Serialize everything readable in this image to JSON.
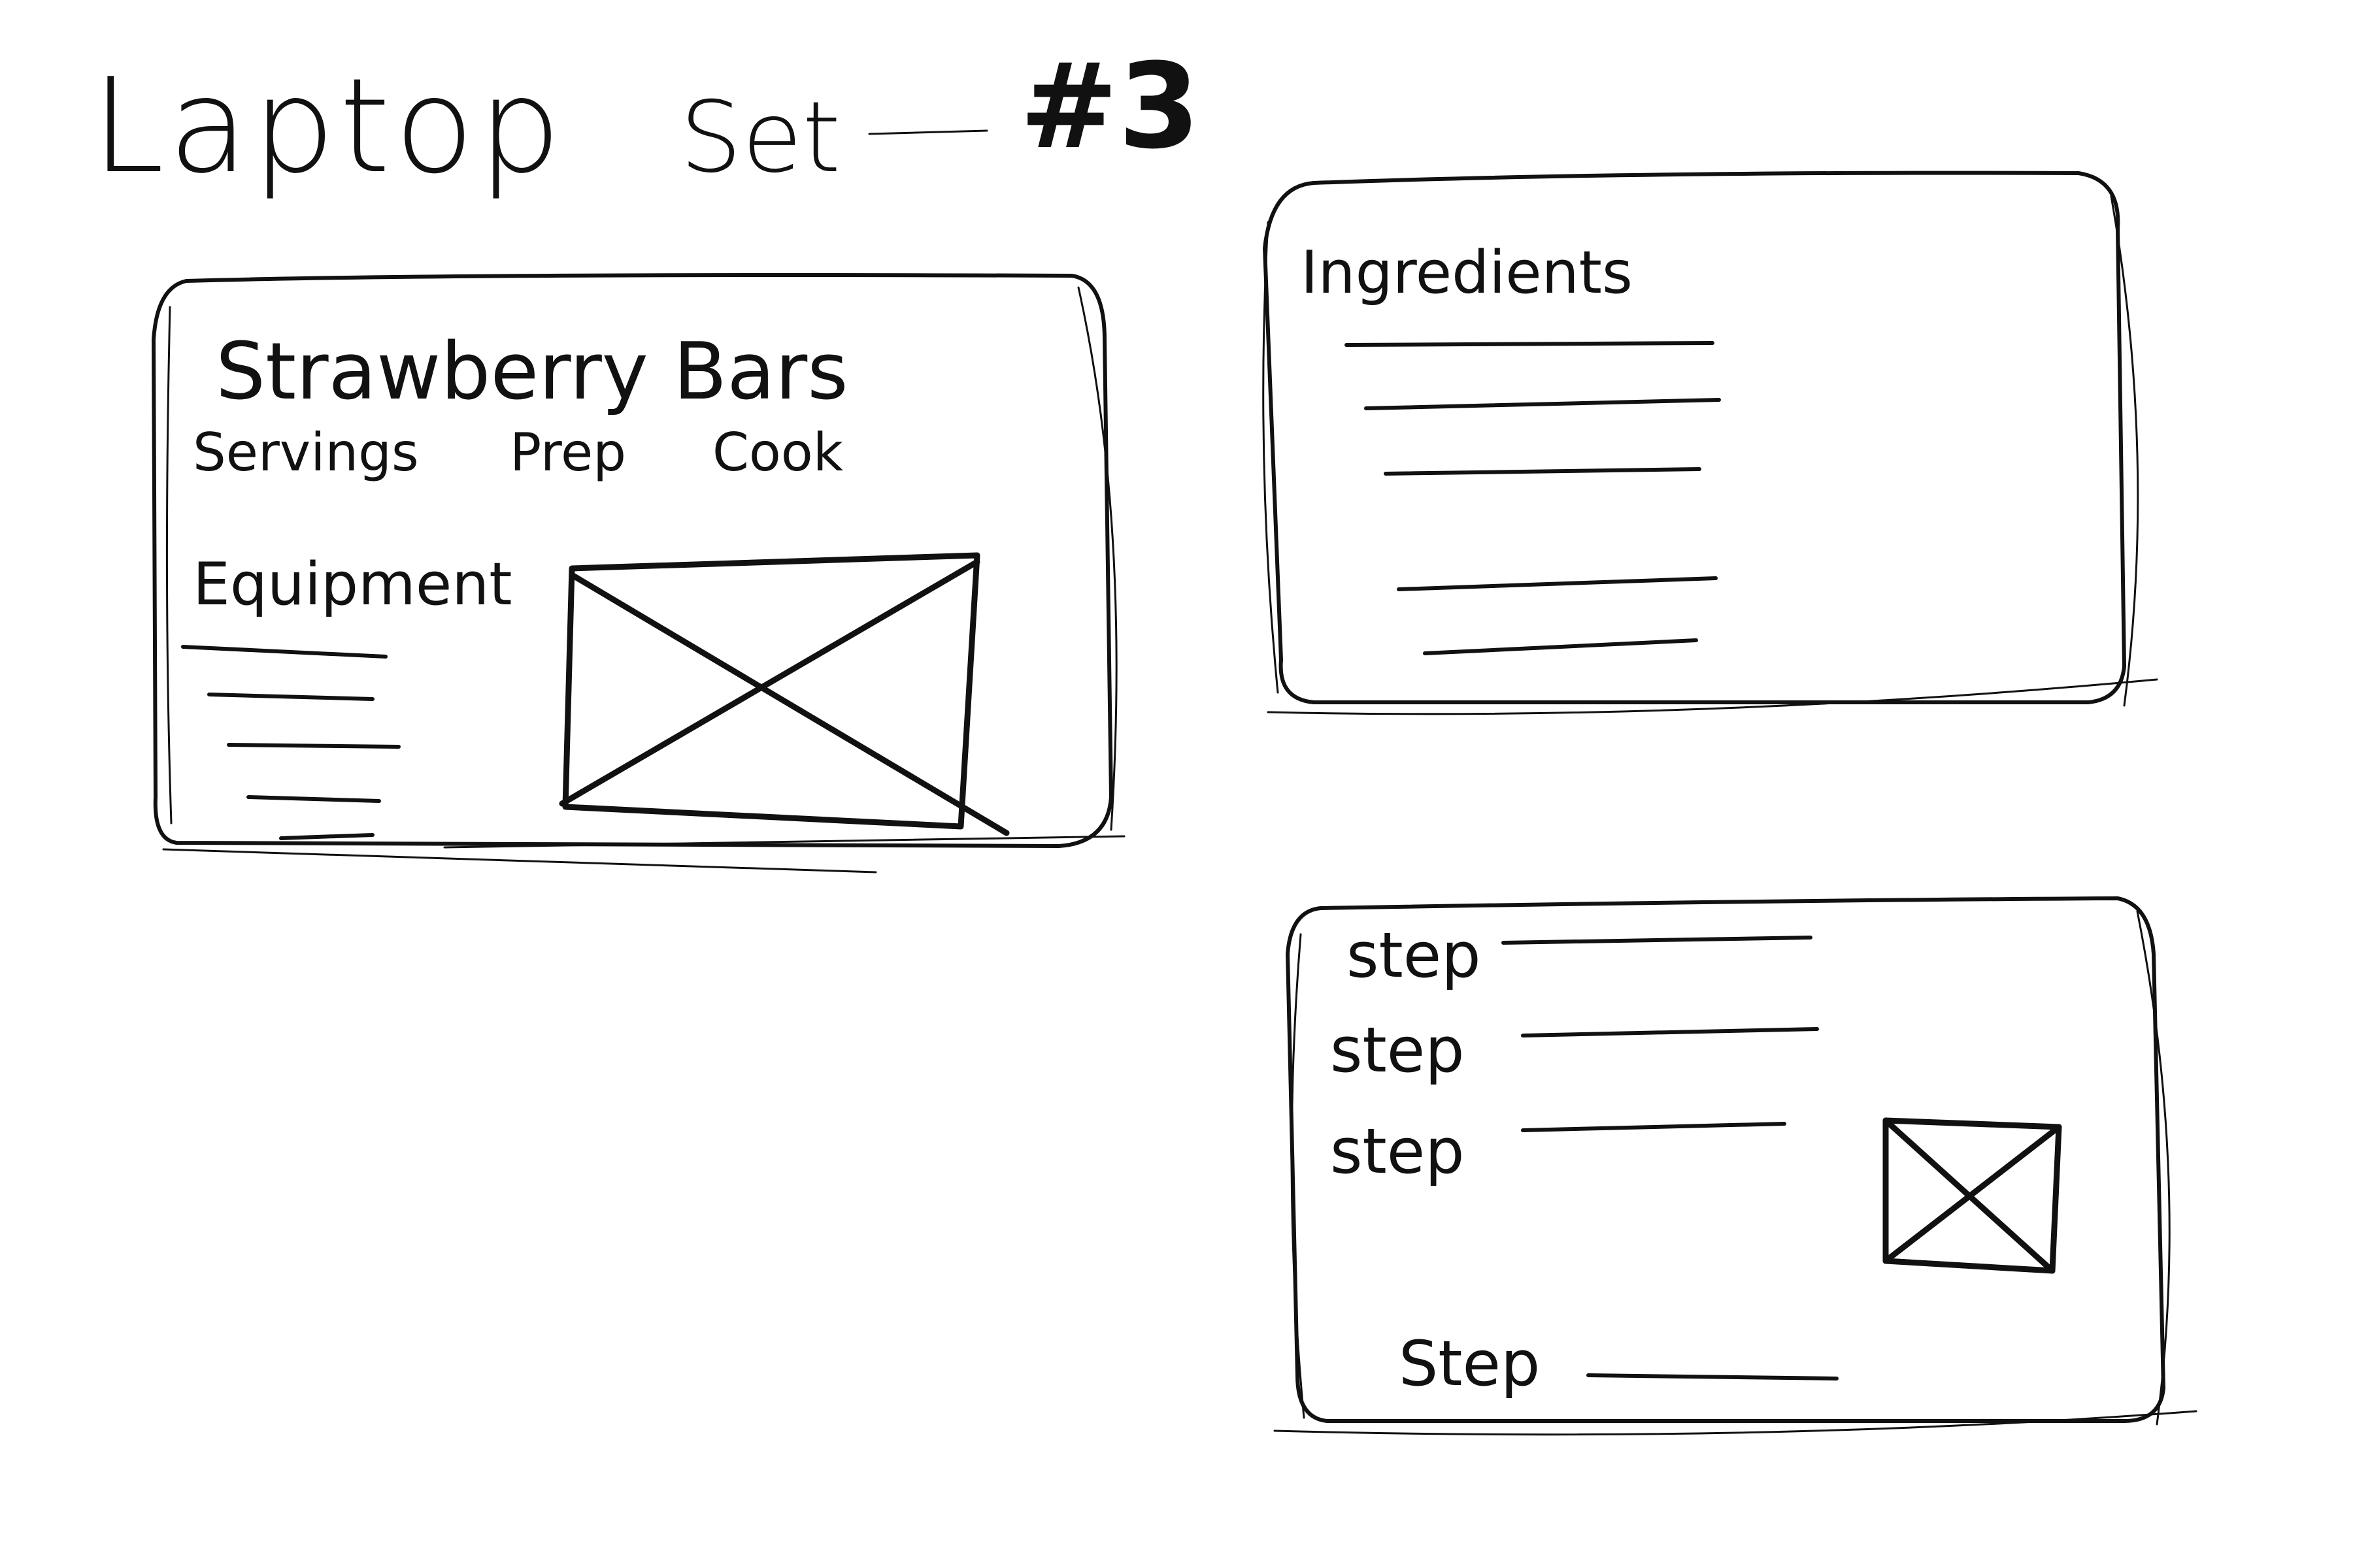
{
  "header": {
    "title": "Laptop",
    "set_label": "Set",
    "set_number": "#3"
  },
  "recipe_card": {
    "title": "Strawberry Bars",
    "meta": [
      "Servings",
      "Prep",
      "Cook"
    ],
    "equipment_heading": "Equipment"
  },
  "ingredients_card": {
    "heading": "Ingredients"
  },
  "steps_card": {
    "steps": [
      "step",
      "step",
      "step",
      "Step"
    ]
  }
}
